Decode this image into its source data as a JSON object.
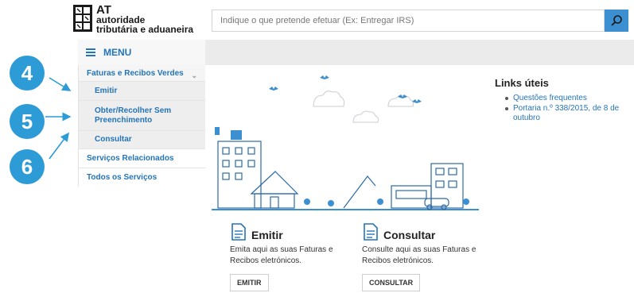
{
  "header": {
    "logo": {
      "abbr": "AT",
      "line1": "autoridade",
      "line2": "tributária e aduaneira"
    },
    "search": {
      "placeholder": "Indique o que pretende efetuar (Ex: Entregar IRS)",
      "value": ""
    },
    "search_icon": "search-icon"
  },
  "menu": {
    "label": "MENU",
    "icon": "hamburger-icon"
  },
  "sidebar": {
    "items": [
      {
        "label": "Faturas e Recibos Verdes",
        "expanded": true
      },
      {
        "label": "Emitir"
      },
      {
        "label": "Obter/Recolher Sem Preenchimento"
      },
      {
        "label": "Consultar"
      },
      {
        "label": "Serviços Relacionados"
      },
      {
        "label": "Todos os Serviços"
      }
    ]
  },
  "callouts": [
    "4",
    "5",
    "6"
  ],
  "cards": [
    {
      "title": "Emitir",
      "description": "Emita aqui as suas Faturas e Recibos eletrónicos.",
      "button": "EMITIR",
      "icon": "document-icon"
    },
    {
      "title": "Consultar",
      "description": "Consulte aqui as suas Faturas e Recibos eletrónicos.",
      "button": "CONSULTAR",
      "icon": "document-icon"
    }
  ],
  "links": {
    "title": "Links úteis",
    "items": [
      "Questões frequentes",
      "Portaria n.º 338/2015, de 8 de outubro"
    ]
  },
  "colors": {
    "brand_blue": "#2474b8",
    "callout_blue": "#2d9bd6",
    "search_button": "#3c8fd0"
  }
}
